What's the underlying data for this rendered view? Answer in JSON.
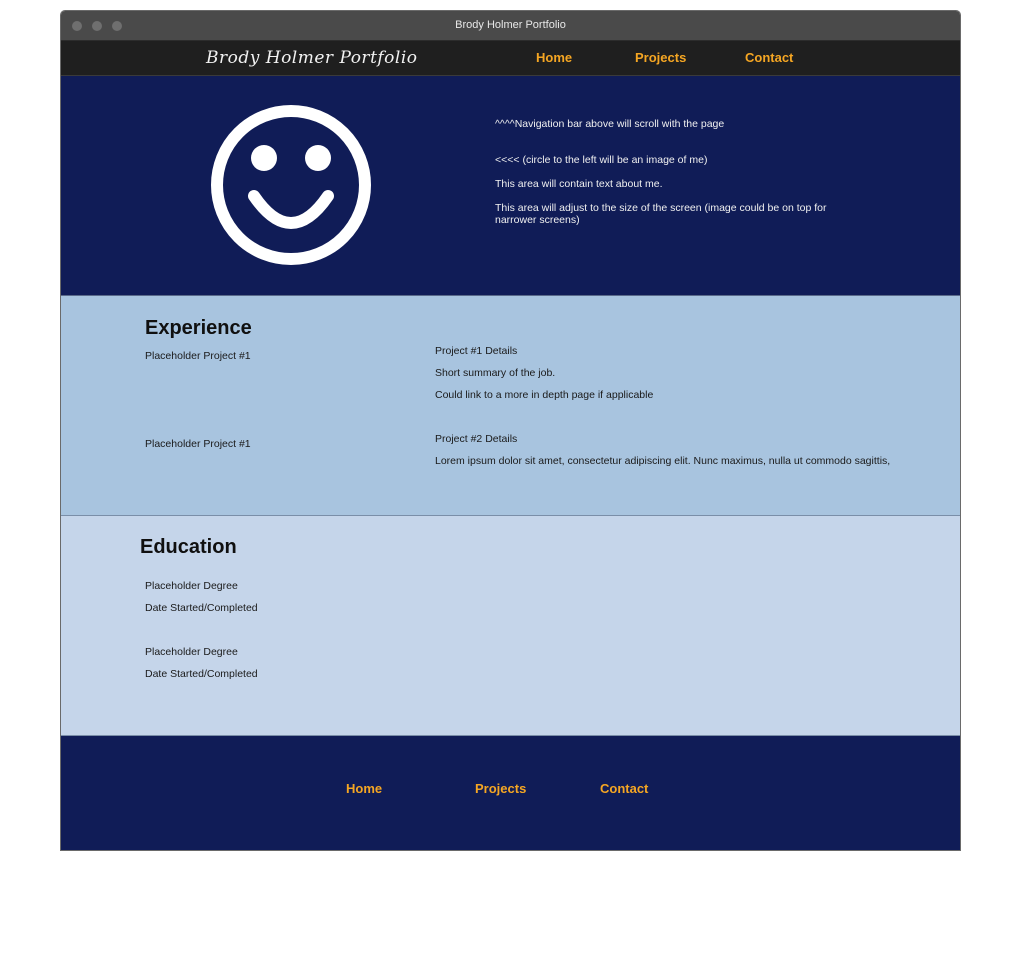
{
  "window": {
    "title": "Brody Holmer Portfolio"
  },
  "navbar": {
    "brand": "Brody Holmer Portfolio",
    "links": [
      "Home",
      "Projects",
      "Contact"
    ]
  },
  "hero": {
    "avatar_icon": "smiley-face-icon",
    "lines": [
      "^^^^Navigation bar above will scroll with the page",
      "<<<< (circle to the left will be an image of me)",
      "This area will contain text about me.",
      "This area will adjust to the size of the screen (image could be on top for narrower screens)"
    ]
  },
  "experience": {
    "title": "Experience",
    "projects": [
      {
        "name": "Placeholder Project #1",
        "details_title": "Project #1 Details",
        "details": [
          "Short summary of the job.",
          "Could link to a more in depth page if applicable"
        ]
      },
      {
        "name": "Placeholder Project #1",
        "details_title": "Project #2 Details",
        "details": [
          "Lorem ipsum dolor sit amet, consectetur adipiscing elit. Nunc maximus, nulla ut commodo sagittis,"
        ]
      }
    ]
  },
  "education": {
    "title": "Education",
    "entries": [
      {
        "degree": "Placeholder Degree",
        "dates": "Date Started/Completed"
      },
      {
        "degree": "Placeholder Degree",
        "dates": "Date Started/Completed"
      }
    ]
  },
  "footer": {
    "links": [
      "Home",
      "Projects",
      "Contact"
    ]
  },
  "colors": {
    "nav_bg": "#1f1f1f",
    "hero_bg": "#101c57",
    "experience_bg": "#a8c4df",
    "education_bg": "#c5d5ea",
    "link_accent": "#f5a623"
  }
}
